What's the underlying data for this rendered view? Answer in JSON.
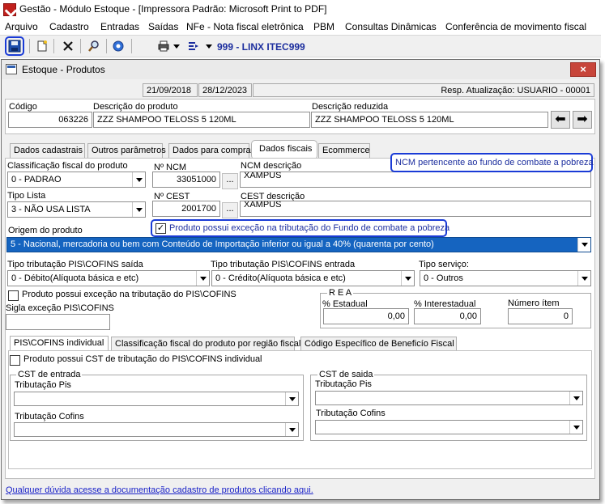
{
  "app": {
    "title": "Gestão  -  Módulo Estoque - [Impressora Padrão: Microsoft Print to PDF]"
  },
  "menu": [
    "Arquivo",
    "Cadastro",
    "Entradas",
    "Saídas",
    "NFe - Nota fiscal eletrônica",
    "PBM",
    "Consultas Dinâmicas",
    "Conferência de movimento fiscal"
  ],
  "toolbar": {
    "company": "999 - LINX ITEC999"
  },
  "window": {
    "title": "Estoque - Produtos",
    "close": "×"
  },
  "info": {
    "date1": "21/09/2018",
    "date2": "28/12/2023",
    "resp": "Resp. Atualização: USUARIO - 00001"
  },
  "product": {
    "codigo_label": "Código",
    "codigo": "063226",
    "descricao_label": "Descrição  do produto",
    "descricao": "ZZZ SHAMPOO TELOSS 5 120ML",
    "reduzida_label": "Descrição reduzida",
    "reduzida": "ZZZ SHAMPOO TELOSS 5 120ML"
  },
  "tabs": [
    "Dados cadastrais",
    "Outros parâmetros",
    "Dados para compra",
    "Dados fiscais",
    "Ecommerce"
  ],
  "fiscal": {
    "class_label": "Classificação fiscal do produto",
    "class_value": "0 - PADRAO",
    "ncm_label": "Nº NCM",
    "ncm_value": "33051000",
    "ncm_desc_label": "NCM descrição",
    "ncm_desc": "XAMPUS",
    "ncm_note": "NCM pertencente ao fundo de combate a pobreza",
    "tipo_lista_label": "Tipo Lista",
    "tipo_lista_value": "3 - NÃO USA LISTA",
    "cest_label": "Nº CEST",
    "cest_value": "2001700",
    "cest_desc_label": "CEST descrição",
    "cest_desc": "XAMPUS",
    "origem_label": "Origem do produto",
    "pobreza_check_label": "Produto possui exceção na tributação do Fundo de combate a pobreza",
    "origem_value": "5 - Nacional, mercadoria ou bem com Conteúdo de Importação inferior ou igual a 40% (quarenta por cento)",
    "pis_saida_label": "Tipo tributação PIS\\COFINS saída",
    "pis_saida_value": "0 - Débito(Alíquota básica e etc)",
    "pis_entrada_label": "Tipo tributação PIS\\COFINS entrada",
    "pis_entrada_value": "0 - Crédito(Alíquota básica e etc)",
    "tipo_servico_label": "Tipo serviço:",
    "tipo_servico_value": "0 - Outros",
    "excecao_pis_label": "Produto possui exceção na tributação do PIS\\COFINS",
    "sigla_label": "Sigla exceção PIS\\COFINS",
    "rea_title": "R E A",
    "estadual_label": "% Estadual",
    "estadual_value": "0,00",
    "interestadual_label": "% Interestadual",
    "interestadual_value": "0,00",
    "numero_item_label": "Número ítem",
    "numero_item_value": "0"
  },
  "subtabs": [
    "PIS\\COFINS individual",
    "Classificação fiscal do produto por região fiscal",
    "Código Específico de Beneficío Fiscal"
  ],
  "pis_individual": {
    "cst_check_label": "Produto possui CST de tributação do PIS\\COFINS individual",
    "entrada_title": "CST de entrada",
    "saida_title": "CST de saida",
    "trib_pis": "Tributação Pis",
    "trib_cofins": "Tributação Cofins"
  },
  "footer": {
    "link": "Qualquer dúvida acesse a documentação cadastro de produtos clicando aqui."
  }
}
